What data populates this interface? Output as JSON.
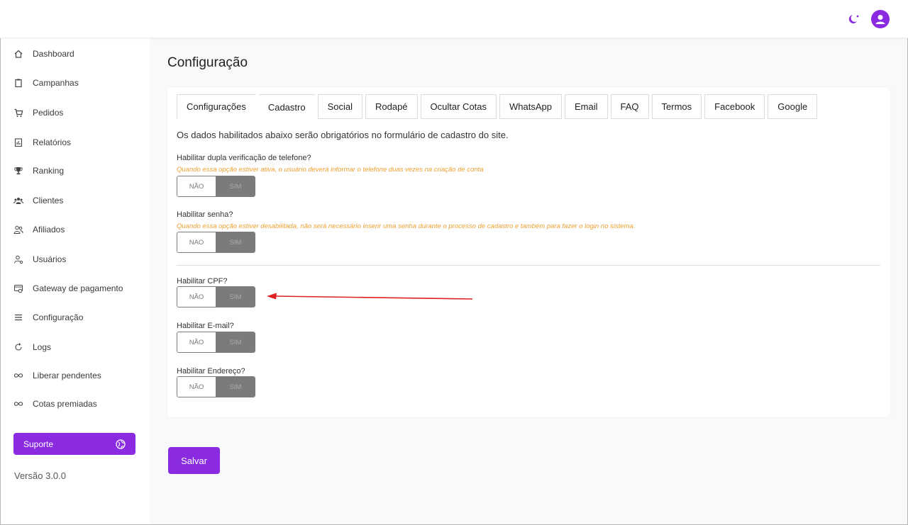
{
  "sidebar": {
    "items": [
      {
        "label": "Dashboard",
        "icon": "home-icon"
      },
      {
        "label": "Campanhas",
        "icon": "clipboard-icon"
      },
      {
        "label": "Pedidos",
        "icon": "cart-icon"
      },
      {
        "label": "Relatórios",
        "icon": "report-icon"
      },
      {
        "label": "Ranking",
        "icon": "trophy-icon"
      },
      {
        "label": "Clientes",
        "icon": "users-icon"
      },
      {
        "label": "Afiliados",
        "icon": "affiliates-icon"
      },
      {
        "label": "Usuários",
        "icon": "user-cog-icon"
      },
      {
        "label": "Gateway de pagamento",
        "icon": "gateway-icon"
      },
      {
        "label": "Configuração",
        "icon": "menu-lines-icon"
      },
      {
        "label": "Logs",
        "icon": "refresh-icon"
      },
      {
        "label": "Liberar pendentes",
        "icon": "infinity-icon"
      },
      {
        "label": "Cotas premiadas",
        "icon": "infinity-icon"
      }
    ],
    "support_label": "Suporte",
    "version": "Versão 3.0.0"
  },
  "main": {
    "title": "Configuração",
    "tabs": [
      {
        "label": "Configurações"
      },
      {
        "label": "Cadastro"
      },
      {
        "label": "Social"
      },
      {
        "label": "Rodapé"
      },
      {
        "label": "Ocultar Cotas"
      },
      {
        "label": "WhatsApp"
      },
      {
        "label": "Email"
      },
      {
        "label": "FAQ"
      },
      {
        "label": "Termos"
      },
      {
        "label": "Facebook"
      },
      {
        "label": "Google"
      }
    ],
    "description": "Os dados habilitados abaixo serão obrigatórios no formulário de cadastro do site.",
    "fields": [
      {
        "label": "Habilitar dupla verificação de telefone?",
        "hint": "Quando essa opção estiver ativa, o usuário deverá informar o telefone duas vezes na criação de conta",
        "off": "NÃO",
        "on": "SIM"
      },
      {
        "label": "Habilitar senha?",
        "hint": "Quando essa opção estiver desabilitada, não será necessário inserir uma senha durante o processo de cadastro e também para fazer o login no sistema.",
        "off": "NAO",
        "on": "SIM"
      },
      {
        "label": "Habilitar CPF?",
        "off": "NÃO",
        "on": "SIM"
      },
      {
        "label": "Habilitar E-mail?",
        "off": "NÃO",
        "on": "SIM"
      },
      {
        "label": "Habilitar Endereço?",
        "off": "NÃO",
        "on": "SIM"
      }
    ],
    "save_label": "Salvar"
  },
  "colors": {
    "accent": "#8a2be2",
    "hint": "#f0a030",
    "arrow": "#e02020",
    "toggle_on": "#7b7b7b"
  }
}
